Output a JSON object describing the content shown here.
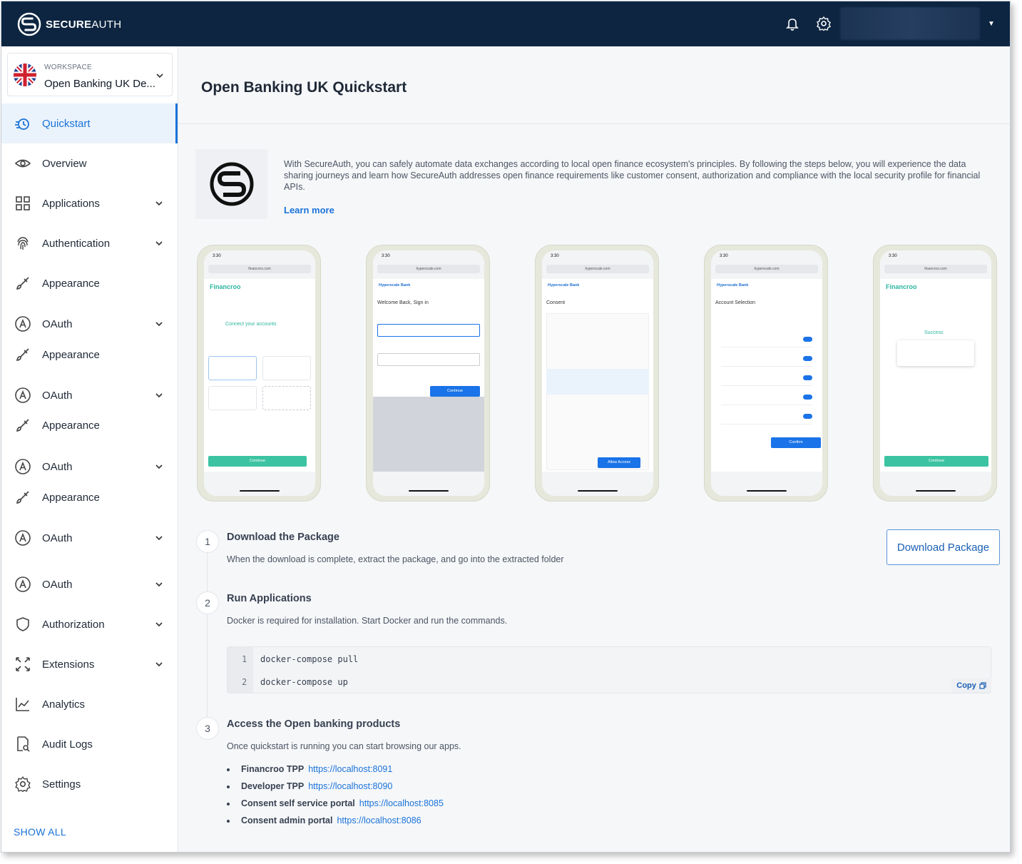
{
  "header": {
    "brand_bold": "SECURE",
    "brand_thin": "AUTH",
    "notifications_icon": "bell-icon",
    "settings_icon": "gear-icon"
  },
  "workspace": {
    "label": "WORKSPACE",
    "name": "Open Banking UK De..."
  },
  "sidebar": {
    "items": [
      {
        "label": "Quickstart",
        "icon": "quickstart-icon",
        "expandable": false,
        "active": true
      },
      {
        "label": "Overview",
        "icon": "eye-icon",
        "expandable": false
      },
      {
        "label": "Applications",
        "icon": "grid-icon",
        "expandable": true
      },
      {
        "label": "Authentication",
        "icon": "fingerprint-icon",
        "expandable": true
      },
      {
        "label": "Appearance",
        "icon": "brush-icon",
        "expandable": false
      },
      {
        "label": "OAuth",
        "icon": "oauth-icon",
        "expandable": true
      },
      {
        "label": "Appearance",
        "icon": "brush-icon",
        "expandable": false
      },
      {
        "label": "OAuth",
        "icon": "oauth-icon",
        "expandable": true
      },
      {
        "label": "Appearance",
        "icon": "brush-icon",
        "expandable": false
      },
      {
        "label": "OAuth",
        "icon": "oauth-icon",
        "expandable": true
      },
      {
        "label": "Appearance",
        "icon": "brush-icon",
        "expandable": false
      },
      {
        "label": "OAuth",
        "icon": "oauth-icon",
        "expandable": true
      },
      {
        "label": "OAuth",
        "icon": "oauth-icon",
        "expandable": true
      },
      {
        "label": "Authorization",
        "icon": "shield-icon",
        "expandable": true
      },
      {
        "label": "Extensions",
        "icon": "extensions-icon",
        "expandable": true
      },
      {
        "label": "Analytics",
        "icon": "chart-icon",
        "expandable": false
      },
      {
        "label": "Audit Logs",
        "icon": "audit-icon",
        "expandable": false
      },
      {
        "label": "Settings",
        "icon": "gear-icon",
        "expandable": false
      }
    ],
    "show_all": "SHOW ALL"
  },
  "main": {
    "title": "Open Banking UK Quickstart",
    "intro": "With SecureAuth, you can safely automate data exchanges according to local open finance ecosystem's principles. By following the steps below, you will experience the data sharing journeys and learn how SecureAuth addresses open finance requirements like customer consent, authorization and compliance with the local security profile for financial APIs.",
    "learn_more": "Learn more",
    "phones": [
      {
        "time": "3:30",
        "url": "financroo.com",
        "brand": "Financroo",
        "heading": "Connect your accounts",
        "button": "Continue"
      },
      {
        "time": "3:30",
        "url": "hyperscale.com",
        "brand": "Hyperscale Bank",
        "heading": "Welcome Back, Sign in",
        "button": "Continue"
      },
      {
        "time": "3:30",
        "url": "hyperscale.com",
        "brand": "Hyperscale Bank",
        "heading": "Consent",
        "button": "Allow Access"
      },
      {
        "time": "3:30",
        "url": "hyperscale.com",
        "brand": "Hyperscale Bank",
        "heading": "Account Selection",
        "button": "Confirm"
      },
      {
        "time": "3:30",
        "url": "financroo.com",
        "brand": "Financroo",
        "heading": "Success",
        "button": "Continue"
      }
    ],
    "steps": [
      {
        "num": "1",
        "title": "Download the Package",
        "desc": "When the download is complete, extract the package, and go into the extracted folder"
      },
      {
        "num": "2",
        "title": "Run Applications",
        "desc": "Docker is required for installation. Start Docker and run the commands."
      },
      {
        "num": "3",
        "title": "Access the Open banking products",
        "desc": "Once quickstart is running you can start browsing our apps."
      }
    ],
    "download_button": "Download Package",
    "code": {
      "lines": [
        {
          "n": "1",
          "text": "docker-compose pull"
        },
        {
          "n": "2",
          "text": "docker-compose up"
        }
      ],
      "copy": "Copy"
    },
    "links": [
      {
        "name": "Financroo TPP",
        "url": "https://localhost:8091"
      },
      {
        "name": "Developer TPP",
        "url": "https://localhost:8090"
      },
      {
        "name": "Consent self service portal",
        "url": "https://localhost:8085"
      },
      {
        "name": "Consent admin portal",
        "url": "https://localhost:8086"
      }
    ]
  },
  "colors": {
    "topbar": "#0d2541",
    "accent": "#1a73d9",
    "financroo": "#2cb5a0",
    "hyperscale": "#1f6fd1"
  }
}
